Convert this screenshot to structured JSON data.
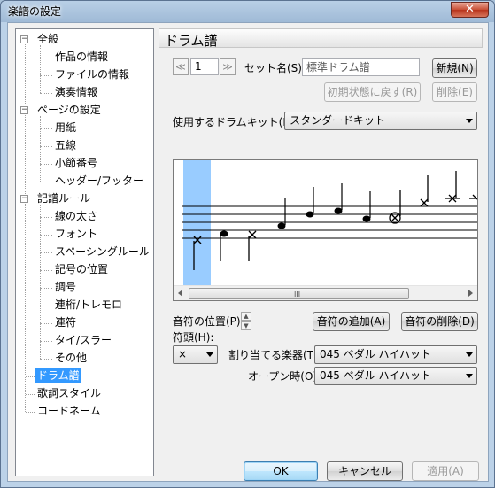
{
  "window": {
    "title": "楽譜の設定",
    "close_label": "✕"
  },
  "tree": {
    "items": [
      {
        "label": "全般",
        "level": 0,
        "expander": "−"
      },
      {
        "label": "作品の情報",
        "level": 1
      },
      {
        "label": "ファイルの情報",
        "level": 1
      },
      {
        "label": "演奏情報",
        "level": 1
      },
      {
        "label": "ページの設定",
        "level": 0,
        "expander": "−"
      },
      {
        "label": "用紙",
        "level": 1
      },
      {
        "label": "五線",
        "level": 1
      },
      {
        "label": "小節番号",
        "level": 1
      },
      {
        "label": "ヘッダー/フッター",
        "level": 1
      },
      {
        "label": "記譜ルール",
        "level": 0,
        "expander": "−"
      },
      {
        "label": "線の太さ",
        "level": 1
      },
      {
        "label": "フォント",
        "level": 1
      },
      {
        "label": "スペーシングルール",
        "level": 1
      },
      {
        "label": "記号の位置",
        "level": 1
      },
      {
        "label": "調号",
        "level": 1
      },
      {
        "label": "連桁/トレモロ",
        "level": 1
      },
      {
        "label": "連符",
        "level": 1
      },
      {
        "label": "タイ/スラー",
        "level": 1
      },
      {
        "label": "その他",
        "level": 1
      },
      {
        "label": "ドラム譜",
        "level": 0,
        "selected": true
      },
      {
        "label": "歌詞スタイル",
        "level": 0
      },
      {
        "label": "コードネーム",
        "level": 0
      }
    ]
  },
  "panel": {
    "title": "ドラム譜",
    "prev_icon": "≪",
    "next_icon": "≫",
    "set_number": "1",
    "set_name_label": "セット名(S):",
    "set_name_value": "標準ドラム譜",
    "new_button": "新規(N)",
    "reset_button": "初期状態に戻す(R)",
    "delete_button": "削除(E)",
    "drumkit_label": "使用するドラムキット(K):",
    "drumkit_value": "スタンダードキット",
    "note_position_label": "音符の位置(P)",
    "add_note_button": "音符の追加(A)",
    "delete_note_button": "音符の削除(D)",
    "notehead_label": "符頭(H):",
    "notehead_value": "×",
    "instrument_label": "割り当てる楽器(T):",
    "instrument_value": "045 ペダル ハイハット",
    "open_label": "オープン時(O):",
    "open_value": "045 ペダル ハイハット",
    "scroll_grip": "III"
  },
  "footer": {
    "ok_button": "OK",
    "cancel_button": "キャンセル",
    "apply_button": "適用(A)"
  },
  "colors": {
    "selection": "#3399ff",
    "highlight_column": "#99ccff"
  }
}
